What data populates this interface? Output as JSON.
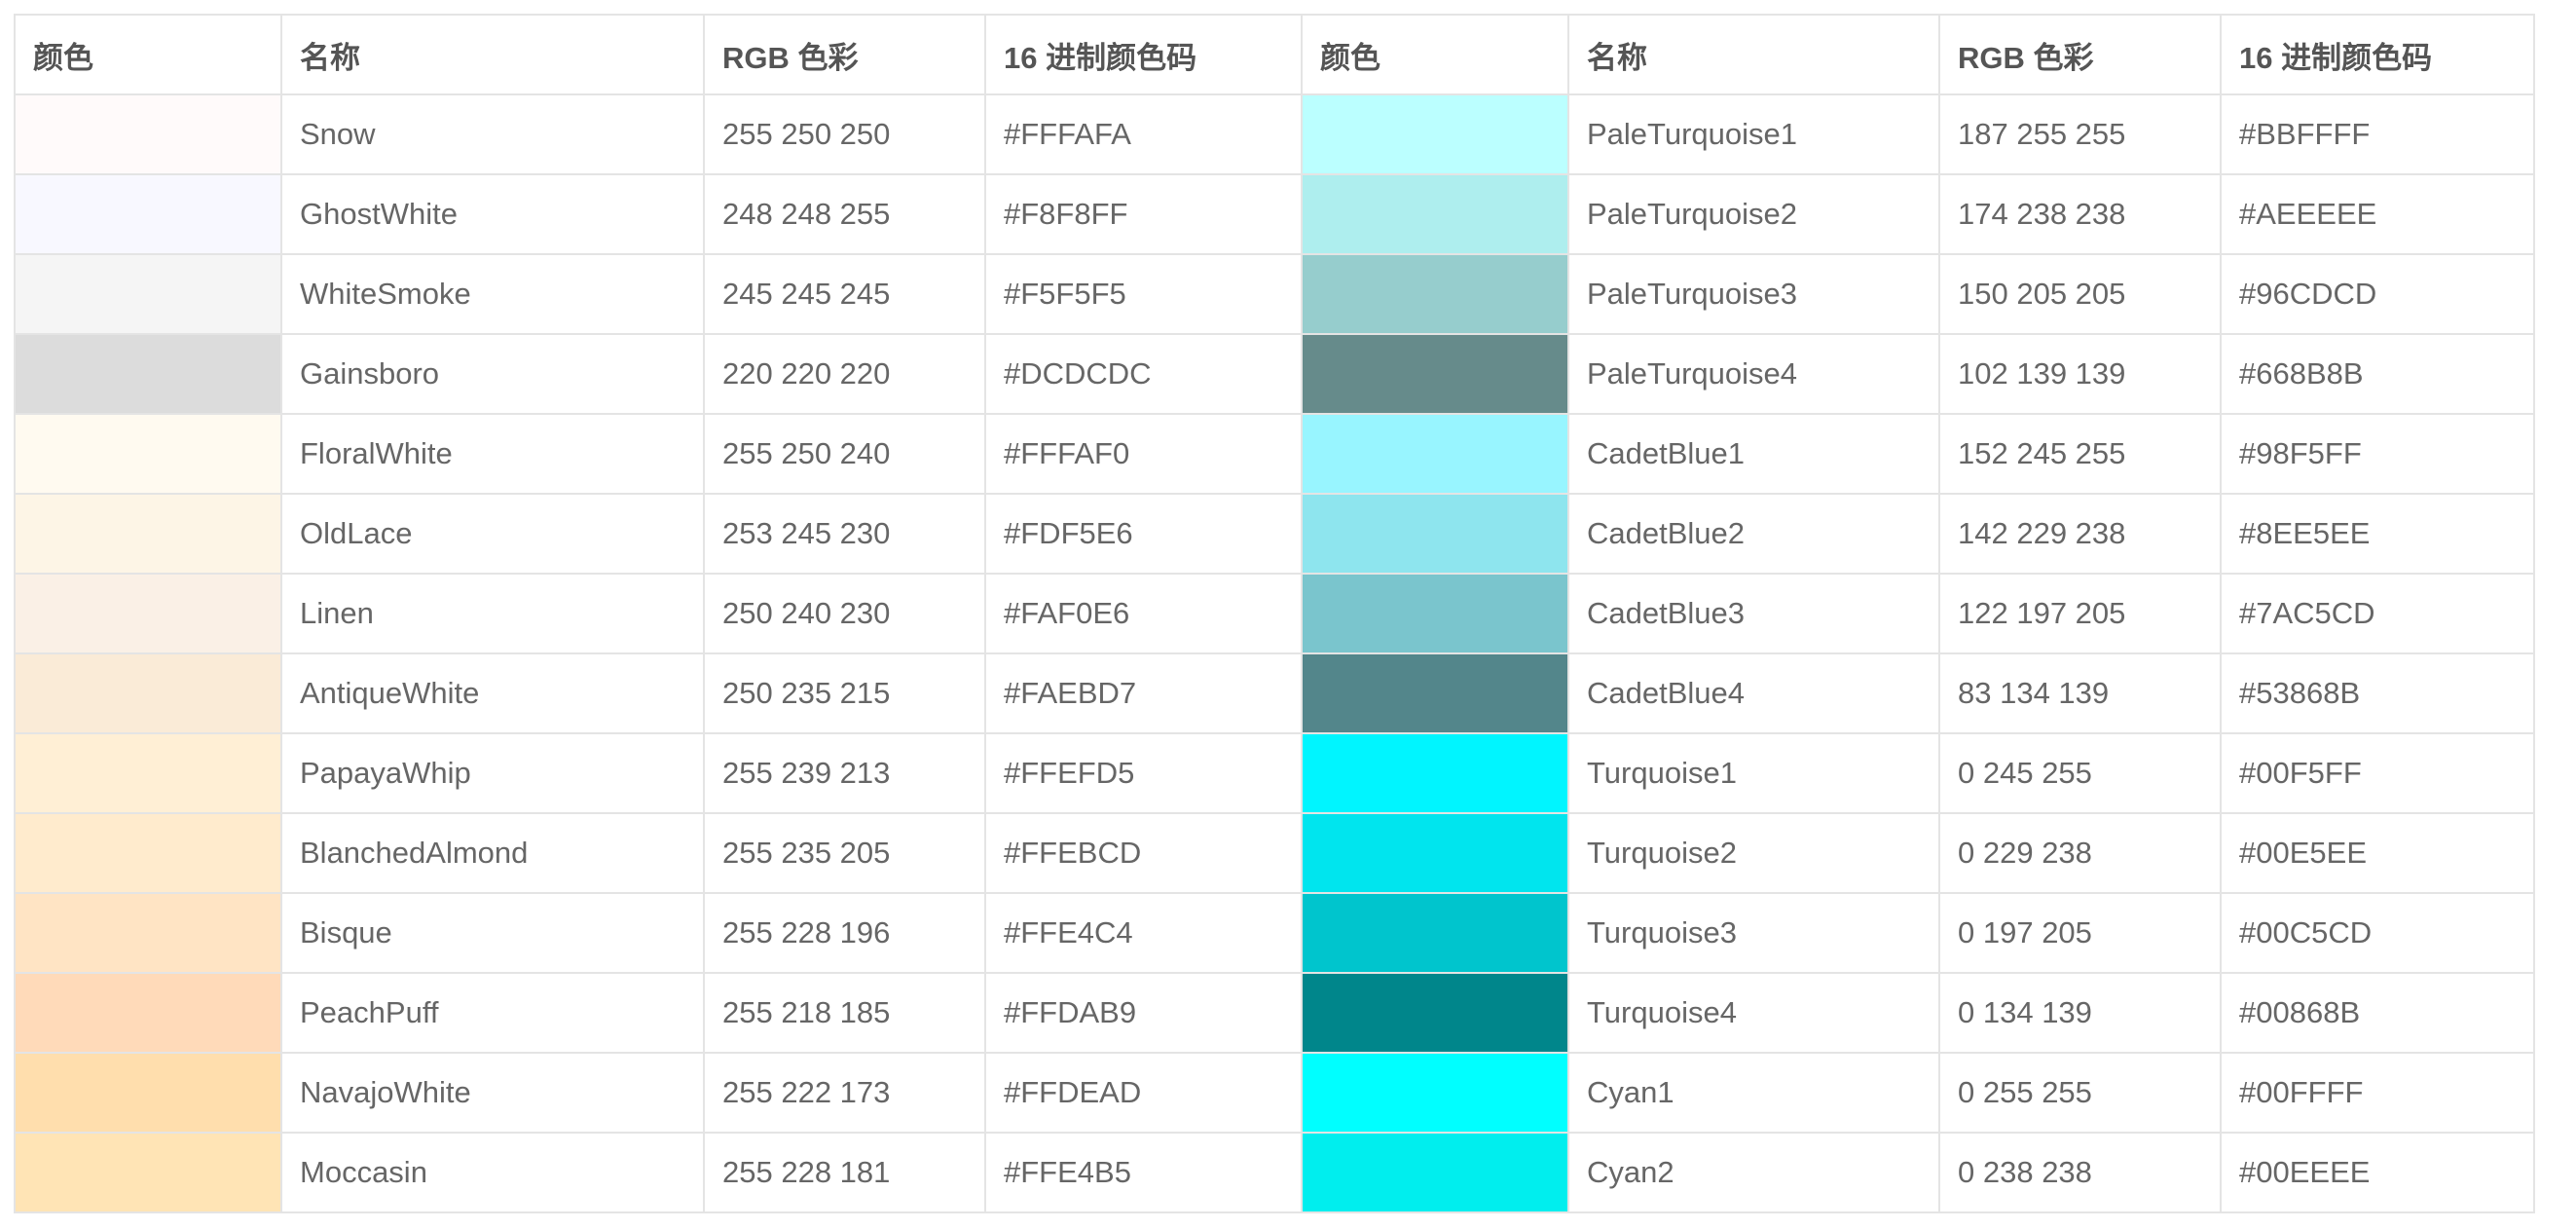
{
  "columns": [
    "颜色",
    "名称",
    "RGB 色彩",
    "16 进制颜色码",
    "颜色",
    "名称",
    "RGB 色彩",
    "16 进制颜色码"
  ],
  "rows": [
    {
      "left": {
        "name": "Snow",
        "rgb": "255 250 250",
        "hex": "#FFFAFA"
      },
      "right": {
        "name": "PaleTurquoise1",
        "rgb": "187 255 255",
        "hex": "#BBFFFF"
      }
    },
    {
      "left": {
        "name": "GhostWhite",
        "rgb": "248 248 255",
        "hex": "#F8F8FF"
      },
      "right": {
        "name": "PaleTurquoise2",
        "rgb": "174 238 238",
        "hex": "#AEEEEE"
      }
    },
    {
      "left": {
        "name": "WhiteSmoke",
        "rgb": "245 245 245",
        "hex": "#F5F5F5"
      },
      "right": {
        "name": "PaleTurquoise3",
        "rgb": "150 205 205",
        "hex": "#96CDCD"
      }
    },
    {
      "left": {
        "name": "Gainsboro",
        "rgb": "220 220 220",
        "hex": "#DCDCDC"
      },
      "right": {
        "name": "PaleTurquoise4",
        "rgb": "102 139 139",
        "hex": "#668B8B"
      }
    },
    {
      "left": {
        "name": "FloralWhite",
        "rgb": "255 250 240",
        "hex": "#FFFAF0"
      },
      "right": {
        "name": "CadetBlue1",
        "rgb": "152 245 255",
        "hex": "#98F5FF"
      }
    },
    {
      "left": {
        "name": "OldLace",
        "rgb": "253 245 230",
        "hex": "#FDF5E6"
      },
      "right": {
        "name": "CadetBlue2",
        "rgb": "142 229 238",
        "hex": "#8EE5EE"
      }
    },
    {
      "left": {
        "name": "Linen",
        "rgb": "250 240 230",
        "hex": "#FAF0E6"
      },
      "right": {
        "name": "CadetBlue3",
        "rgb": "122 197 205",
        "hex": "#7AC5CD"
      }
    },
    {
      "left": {
        "name": "AntiqueWhite",
        "rgb": "250 235 215",
        "hex": "#FAEBD7"
      },
      "right": {
        "name": "CadetBlue4",
        "rgb": "83 134 139",
        "hex": "#53868B"
      }
    },
    {
      "left": {
        "name": "PapayaWhip",
        "rgb": "255 239 213",
        "hex": "#FFEFD5"
      },
      "right": {
        "name": "Turquoise1",
        "rgb": "0 245 255",
        "hex": "#00F5FF"
      }
    },
    {
      "left": {
        "name": "BlanchedAlmond",
        "rgb": "255 235 205",
        "hex": "#FFEBCD"
      },
      "right": {
        "name": "Turquoise2",
        "rgb": "0 229 238",
        "hex": "#00E5EE"
      }
    },
    {
      "left": {
        "name": "Bisque",
        "rgb": "255 228 196",
        "hex": "#FFE4C4"
      },
      "right": {
        "name": "Turquoise3",
        "rgb": "0 197 205",
        "hex": "#00C5CD"
      }
    },
    {
      "left": {
        "name": "PeachPuff",
        "rgb": "255 218 185",
        "hex": "#FFDAB9"
      },
      "right": {
        "name": "Turquoise4",
        "rgb": "0 134 139",
        "hex": "#00868B"
      }
    },
    {
      "left": {
        "name": "NavajoWhite",
        "rgb": "255 222 173",
        "hex": "#FFDEAD"
      },
      "right": {
        "name": "Cyan1",
        "rgb": "0 255 255",
        "hex": "#00FFFF"
      }
    },
    {
      "left": {
        "name": "Moccasin",
        "rgb": "255 228 181",
        "hex": "#FFE4B5"
      },
      "right": {
        "name": "Cyan2",
        "rgb": "0 238 238",
        "hex": "#00EEEE"
      }
    }
  ]
}
